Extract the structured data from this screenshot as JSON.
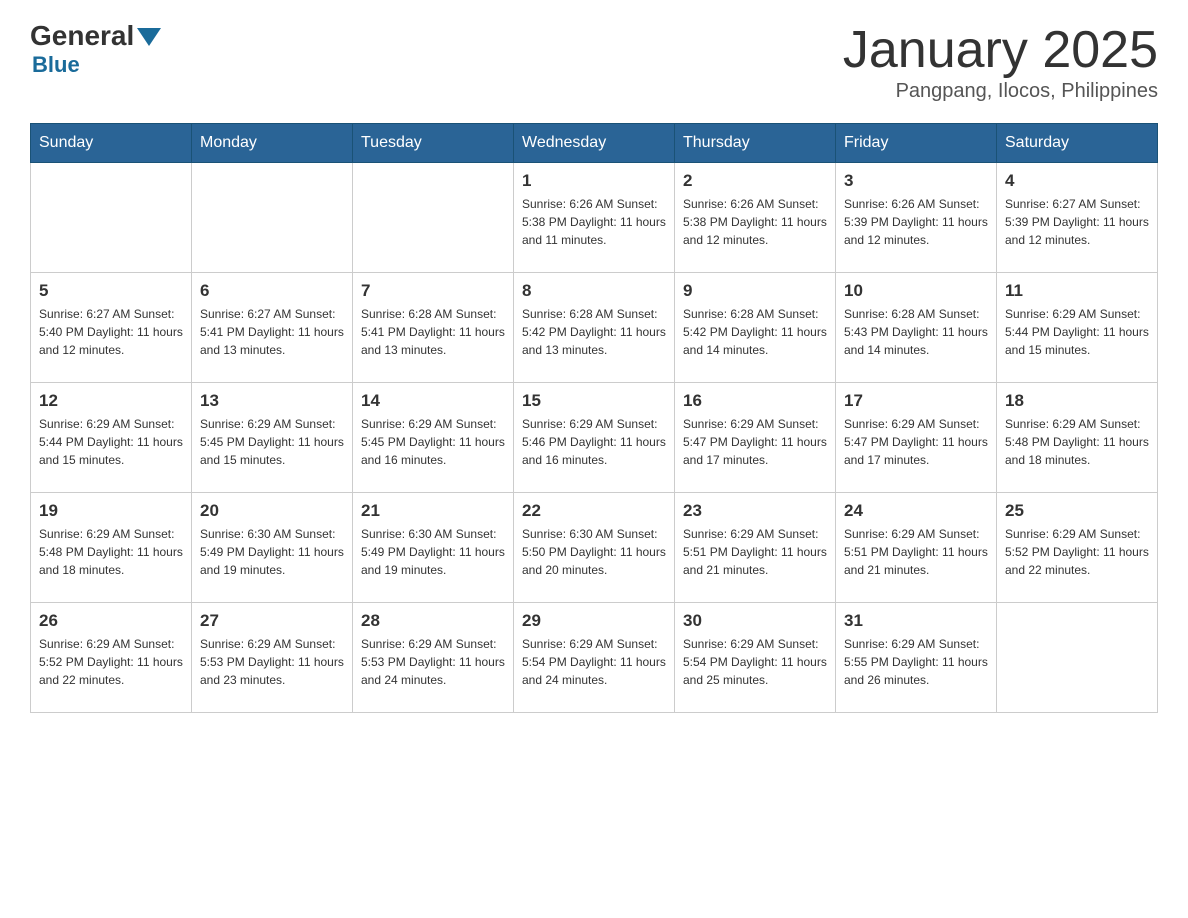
{
  "header": {
    "logo": {
      "general": "General",
      "blue": "Blue"
    },
    "title": "January 2025",
    "location": "Pangpang, Ilocos, Philippines"
  },
  "days_of_week": [
    "Sunday",
    "Monday",
    "Tuesday",
    "Wednesday",
    "Thursday",
    "Friday",
    "Saturday"
  ],
  "weeks": [
    {
      "days": [
        {
          "day": "",
          "info": ""
        },
        {
          "day": "",
          "info": ""
        },
        {
          "day": "",
          "info": ""
        },
        {
          "day": "1",
          "info": "Sunrise: 6:26 AM\nSunset: 5:38 PM\nDaylight: 11 hours\nand 11 minutes."
        },
        {
          "day": "2",
          "info": "Sunrise: 6:26 AM\nSunset: 5:38 PM\nDaylight: 11 hours\nand 12 minutes."
        },
        {
          "day": "3",
          "info": "Sunrise: 6:26 AM\nSunset: 5:39 PM\nDaylight: 11 hours\nand 12 minutes."
        },
        {
          "day": "4",
          "info": "Sunrise: 6:27 AM\nSunset: 5:39 PM\nDaylight: 11 hours\nand 12 minutes."
        }
      ]
    },
    {
      "days": [
        {
          "day": "5",
          "info": "Sunrise: 6:27 AM\nSunset: 5:40 PM\nDaylight: 11 hours\nand 12 minutes."
        },
        {
          "day": "6",
          "info": "Sunrise: 6:27 AM\nSunset: 5:41 PM\nDaylight: 11 hours\nand 13 minutes."
        },
        {
          "day": "7",
          "info": "Sunrise: 6:28 AM\nSunset: 5:41 PM\nDaylight: 11 hours\nand 13 minutes."
        },
        {
          "day": "8",
          "info": "Sunrise: 6:28 AM\nSunset: 5:42 PM\nDaylight: 11 hours\nand 13 minutes."
        },
        {
          "day": "9",
          "info": "Sunrise: 6:28 AM\nSunset: 5:42 PM\nDaylight: 11 hours\nand 14 minutes."
        },
        {
          "day": "10",
          "info": "Sunrise: 6:28 AM\nSunset: 5:43 PM\nDaylight: 11 hours\nand 14 minutes."
        },
        {
          "day": "11",
          "info": "Sunrise: 6:29 AM\nSunset: 5:44 PM\nDaylight: 11 hours\nand 15 minutes."
        }
      ]
    },
    {
      "days": [
        {
          "day": "12",
          "info": "Sunrise: 6:29 AM\nSunset: 5:44 PM\nDaylight: 11 hours\nand 15 minutes."
        },
        {
          "day": "13",
          "info": "Sunrise: 6:29 AM\nSunset: 5:45 PM\nDaylight: 11 hours\nand 15 minutes."
        },
        {
          "day": "14",
          "info": "Sunrise: 6:29 AM\nSunset: 5:45 PM\nDaylight: 11 hours\nand 16 minutes."
        },
        {
          "day": "15",
          "info": "Sunrise: 6:29 AM\nSunset: 5:46 PM\nDaylight: 11 hours\nand 16 minutes."
        },
        {
          "day": "16",
          "info": "Sunrise: 6:29 AM\nSunset: 5:47 PM\nDaylight: 11 hours\nand 17 minutes."
        },
        {
          "day": "17",
          "info": "Sunrise: 6:29 AM\nSunset: 5:47 PM\nDaylight: 11 hours\nand 17 minutes."
        },
        {
          "day": "18",
          "info": "Sunrise: 6:29 AM\nSunset: 5:48 PM\nDaylight: 11 hours\nand 18 minutes."
        }
      ]
    },
    {
      "days": [
        {
          "day": "19",
          "info": "Sunrise: 6:29 AM\nSunset: 5:48 PM\nDaylight: 11 hours\nand 18 minutes."
        },
        {
          "day": "20",
          "info": "Sunrise: 6:30 AM\nSunset: 5:49 PM\nDaylight: 11 hours\nand 19 minutes."
        },
        {
          "day": "21",
          "info": "Sunrise: 6:30 AM\nSunset: 5:49 PM\nDaylight: 11 hours\nand 19 minutes."
        },
        {
          "day": "22",
          "info": "Sunrise: 6:30 AM\nSunset: 5:50 PM\nDaylight: 11 hours\nand 20 minutes."
        },
        {
          "day": "23",
          "info": "Sunrise: 6:29 AM\nSunset: 5:51 PM\nDaylight: 11 hours\nand 21 minutes."
        },
        {
          "day": "24",
          "info": "Sunrise: 6:29 AM\nSunset: 5:51 PM\nDaylight: 11 hours\nand 21 minutes."
        },
        {
          "day": "25",
          "info": "Sunrise: 6:29 AM\nSunset: 5:52 PM\nDaylight: 11 hours\nand 22 minutes."
        }
      ]
    },
    {
      "days": [
        {
          "day": "26",
          "info": "Sunrise: 6:29 AM\nSunset: 5:52 PM\nDaylight: 11 hours\nand 22 minutes."
        },
        {
          "day": "27",
          "info": "Sunrise: 6:29 AM\nSunset: 5:53 PM\nDaylight: 11 hours\nand 23 minutes."
        },
        {
          "day": "28",
          "info": "Sunrise: 6:29 AM\nSunset: 5:53 PM\nDaylight: 11 hours\nand 24 minutes."
        },
        {
          "day": "29",
          "info": "Sunrise: 6:29 AM\nSunset: 5:54 PM\nDaylight: 11 hours\nand 24 minutes."
        },
        {
          "day": "30",
          "info": "Sunrise: 6:29 AM\nSunset: 5:54 PM\nDaylight: 11 hours\nand 25 minutes."
        },
        {
          "day": "31",
          "info": "Sunrise: 6:29 AM\nSunset: 5:55 PM\nDaylight: 11 hours\nand 26 minutes."
        },
        {
          "day": "",
          "info": ""
        }
      ]
    }
  ]
}
